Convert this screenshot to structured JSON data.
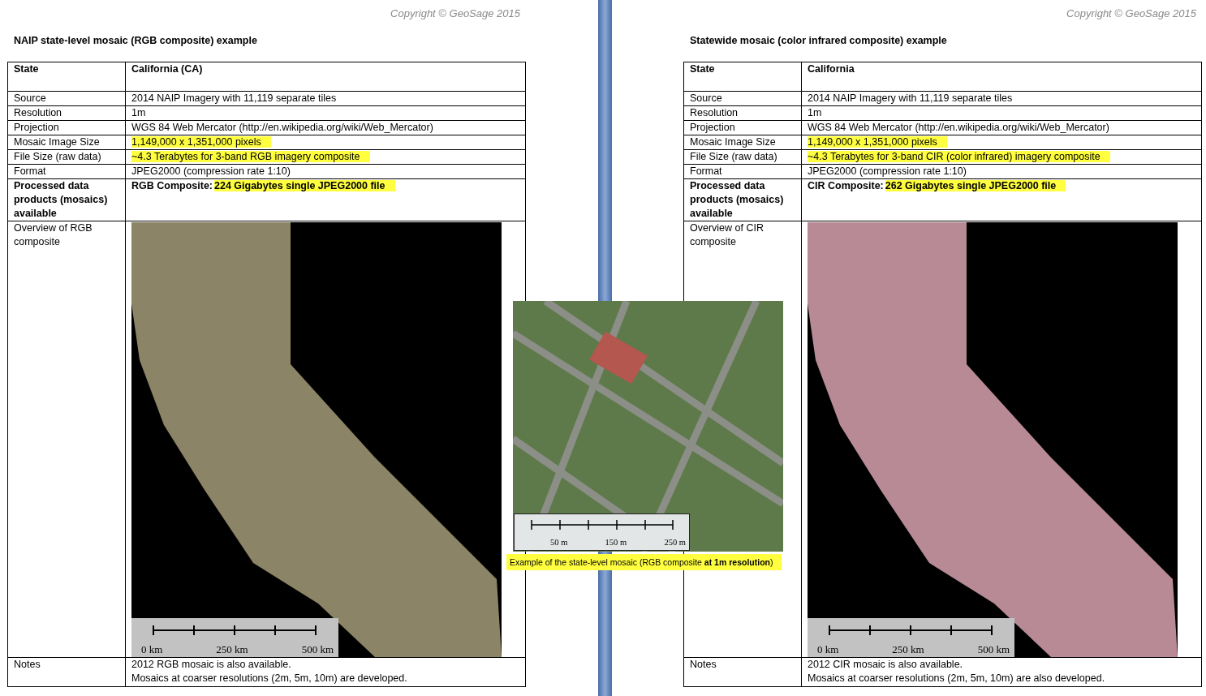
{
  "pages": [
    {
      "copyright": "Copyright © GeoSage 2015",
      "heading": "NAIP state-level mosaic (RGB composite) example",
      "rows": [
        {
          "label": "State",
          "bold": true,
          "parts": [
            {
              "text": "California (CA)",
              "highlighted": false
            }
          ]
        },
        {
          "label": "Source",
          "bold": false,
          "parts": [
            {
              "text": "2014 NAIP Imagery with 11,119 separate tiles",
              "highlighted": false
            }
          ]
        },
        {
          "label": "Resolution",
          "bold": false,
          "parts": [
            {
              "text": "1m",
              "highlighted": false
            }
          ]
        },
        {
          "label": "Projection",
          "bold": false,
          "parts": [
            {
              "text": "WGS 84 Web Mercator (http://en.wikipedia.org/wiki/Web_Mercator)",
              "highlighted": false
            }
          ]
        },
        {
          "label": "Mosaic Image Size",
          "bold": false,
          "parts": [
            {
              "text": "1,149,000 x 1,351,000 pixels",
              "highlighted": true
            }
          ]
        },
        {
          "label": "File Size (raw data)",
          "bold": false,
          "parts": [
            {
              "text": "~4.3 Terabytes for 3-band RGB imagery composite",
              "highlighted": true
            }
          ]
        },
        {
          "label": "Format",
          "bold": false,
          "parts": [
            {
              "text": "JPEG2000 (compression rate 1:10)",
              "highlighted": false
            }
          ]
        },
        {
          "label": "Processed data products (mosaics) available",
          "bold": true,
          "parts": [
            {
              "text": "RGB Composite:",
              "highlighted": false
            },
            {
              "text": "224 Gigabytes single JPEG2000 file",
              "highlighted": true
            }
          ]
        }
      ],
      "overview": {
        "label": "Overview of RGB composite",
        "scale_labels": [
          "0 km",
          "250 km",
          "500 km"
        ]
      },
      "notes": {
        "label": "Notes",
        "lines": [
          "2012 RGB mosaic is also available.",
          "Mosaics at coarser resolutions (2m, 5m, 10m) are developed."
        ]
      }
    },
    {
      "copyright": "Copyright © GeoSage 2015",
      "heading": "Statewide mosaic (color infrared composite) example",
      "rows": [
        {
          "label": "State",
          "bold": true,
          "parts": [
            {
              "text": "California",
              "highlighted": false
            }
          ]
        },
        {
          "label": "Source",
          "bold": false,
          "parts": [
            {
              "text": "2014 NAIP Imagery with 11,119 separate tiles",
              "highlighted": false
            }
          ]
        },
        {
          "label": "Resolution",
          "bold": false,
          "parts": [
            {
              "text": "1m",
              "highlighted": false
            }
          ]
        },
        {
          "label": "Projection",
          "bold": false,
          "parts": [
            {
              "text": "WGS 84 Web Mercator (http://en.wikipedia.org/wiki/Web_Mercator)",
              "highlighted": false
            }
          ]
        },
        {
          "label": "Mosaic Image Size",
          "bold": false,
          "parts": [
            {
              "text": "1,149,000 x 1,351,000 pixels",
              "highlighted": true
            }
          ]
        },
        {
          "label": "File Size (raw data)",
          "bold": false,
          "parts": [
            {
              "text": "~4.3 Terabytes for 3-band CIR (color infrared) imagery composite",
              "highlighted": true
            }
          ]
        },
        {
          "label": "Format",
          "bold": false,
          "parts": [
            {
              "text": "JPEG2000 (compression rate 1:10)",
              "highlighted": false
            }
          ]
        },
        {
          "label": "Processed data products (mosaics) available",
          "bold": true,
          "parts": [
            {
              "text": "CIR Composite:",
              "highlighted": false
            },
            {
              "text": "262 Gigabytes single JPEG2000 file",
              "highlighted": true
            }
          ]
        }
      ],
      "overview": {
        "label": "Overview of CIR composite",
        "scale_labels": [
          "0 km",
          "250 km",
          "500 km"
        ]
      },
      "notes": {
        "label": "Notes",
        "lines": [
          "2012 CIR mosaic is also available.",
          "Mosaics at coarser resolutions (2m, 5m, 10m) are also developed."
        ]
      }
    }
  ],
  "inset": {
    "scale_labels": [
      "50 m",
      "150 m",
      "250 m"
    ],
    "caption": "Example of the state-level mosaic (RGB composite **at 1m resolution**)"
  }
}
